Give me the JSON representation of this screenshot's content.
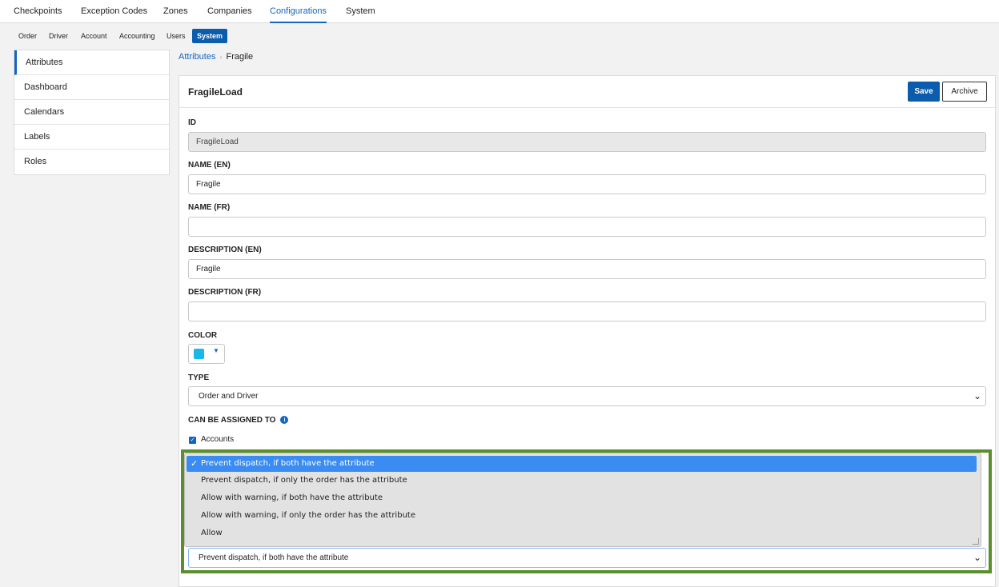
{
  "topnav": {
    "tabs": [
      {
        "label": "Checkpoints"
      },
      {
        "label": "Exception Codes"
      },
      {
        "label": "Zones"
      },
      {
        "label": "Companies"
      },
      {
        "label": "Configurations",
        "active": true
      },
      {
        "label": "System"
      }
    ]
  },
  "subnav": {
    "items": [
      {
        "label": "Order"
      },
      {
        "label": "Driver"
      },
      {
        "label": "Account"
      },
      {
        "label": "Accounting"
      },
      {
        "label": "Users"
      },
      {
        "label": "System",
        "active": true
      }
    ]
  },
  "sidebar": {
    "items": [
      {
        "label": "Attributes",
        "active": true
      },
      {
        "label": "Dashboard"
      },
      {
        "label": "Calendars"
      },
      {
        "label": "Labels"
      },
      {
        "label": "Roles"
      }
    ]
  },
  "breadcrumb": {
    "parent": "Attributes",
    "current": "Fragile"
  },
  "form": {
    "title": "FragileLoad",
    "save_label": "Save",
    "archive_label": "Archive",
    "id_label": "ID",
    "id_value": "FragileLoad",
    "name_en_label": "NAME (EN)",
    "name_en_value": "Fragile",
    "name_fr_label": "NAME (FR)",
    "name_fr_value": "",
    "desc_en_label": "DESCRIPTION (EN)",
    "desc_en_value": "Fragile",
    "desc_fr_label": "DESCRIPTION (FR)",
    "desc_fr_value": "",
    "color_label": "COLOR",
    "color_value": "#1ab7ea",
    "type_label": "TYPE",
    "type_value": "Order and Driver",
    "assign_label": "CAN BE ASSIGNED TO",
    "accounts_label": "Accounts",
    "accounts_checked": true
  },
  "dispatch": {
    "options": [
      "Prevent dispatch, if both have the attribute",
      "Prevent dispatch, if only the order has the attribute",
      "Allow with warning, if both have the attribute",
      "Allow with warning, if only the order has the attribute",
      "Allow"
    ],
    "selected": "Prevent dispatch, if both have the attribute"
  },
  "colors": {
    "accent": "#1565c0",
    "primary_button": "#0b5cad",
    "highlight_border": "#5b8f2e",
    "selected_option": "#3b8cf2"
  }
}
